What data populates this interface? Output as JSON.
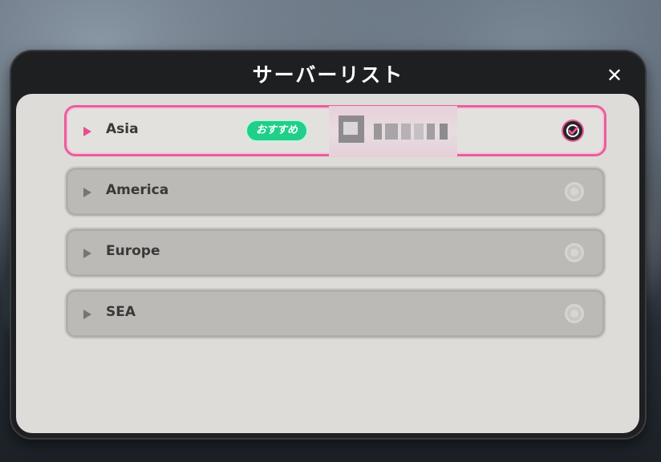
{
  "dialog": {
    "title": "サーバーリスト",
    "close_glyph": "✕"
  },
  "servers": [
    {
      "name": "Asia",
      "selected": true,
      "badge": "おすすめ",
      "radio_icon": "check-circle-icon"
    },
    {
      "name": "America",
      "selected": false,
      "radio_icon": "radio-empty-icon"
    },
    {
      "name": "Europe",
      "selected": false,
      "radio_icon": "radio-empty-icon"
    },
    {
      "name": "SEA",
      "selected": false,
      "radio_icon": "radio-empty-icon"
    }
  ],
  "colors": {
    "accent_pink": "#ea5e9c",
    "badge_green": "#1fcf8a",
    "panel_bg": "#dedcd8",
    "frame_dark": "#1e1f21"
  }
}
